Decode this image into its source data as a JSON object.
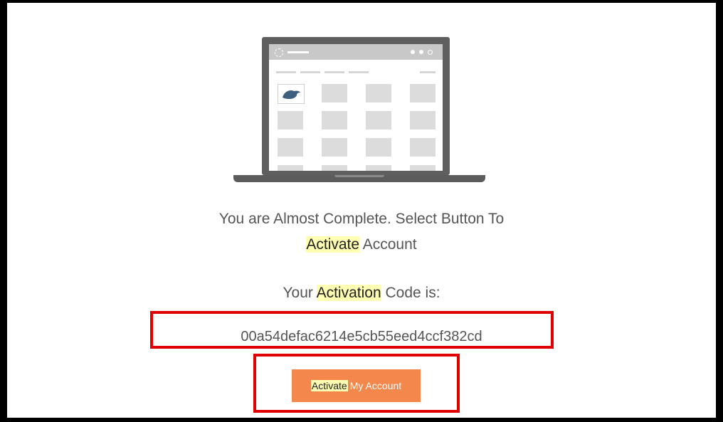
{
  "message": {
    "line1": "You are Almost Complete. Select Button To",
    "line2_highlight": "Activate",
    "line2_rest": "Account"
  },
  "activation": {
    "prefix": "Your",
    "highlight": "Activation",
    "suffix": "Code is:",
    "code": "00a54defac6214e5cb55eed4ccf382cd"
  },
  "button": {
    "highlight": "Activate",
    "rest": "My Account",
    "color": "#f4874b"
  },
  "annotation_color": "#e00000",
  "highlight_color": "#ffffb3",
  "illustration": {
    "name": "laptop-illustration"
  }
}
